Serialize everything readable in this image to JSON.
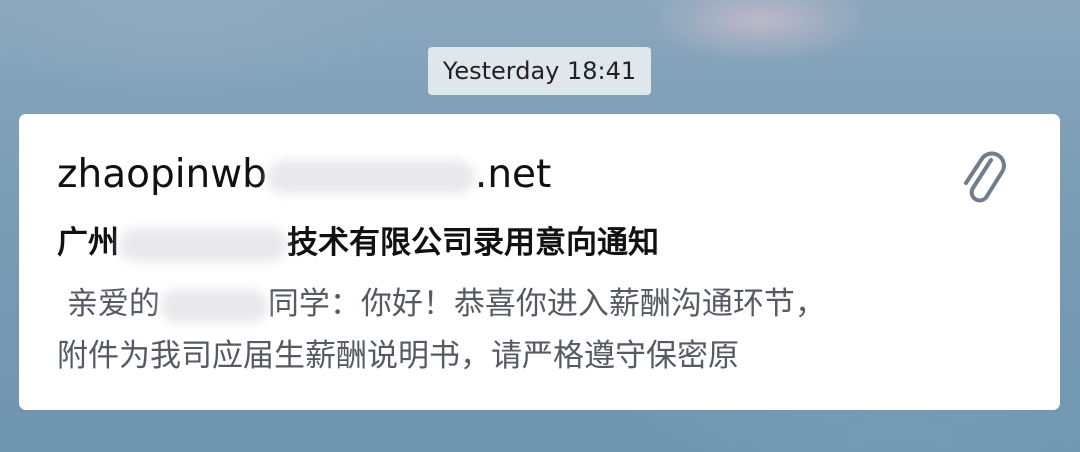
{
  "timestamp": "Yesterday 18:41",
  "email": {
    "sender_prefix": "zhaopinwb",
    "sender_suffix": ".net",
    "subject_prefix": "广州",
    "subject_suffix": "技术有限公司录用意向通知",
    "preview_line1_prefix": " 亲爱的",
    "preview_line1_suffix": "同学：你好！恭喜你进入薪酬沟通环节，",
    "preview_line2": "附件为我司应届生薪酬说明书，请严格遵守保密原",
    "attachment_icon": "paperclip-icon"
  },
  "colors": {
    "card_bg": "#ffffff",
    "timestamp_bg": "#dfe6ec",
    "preview_text": "#555a63",
    "icon": "#6f7d8c"
  }
}
